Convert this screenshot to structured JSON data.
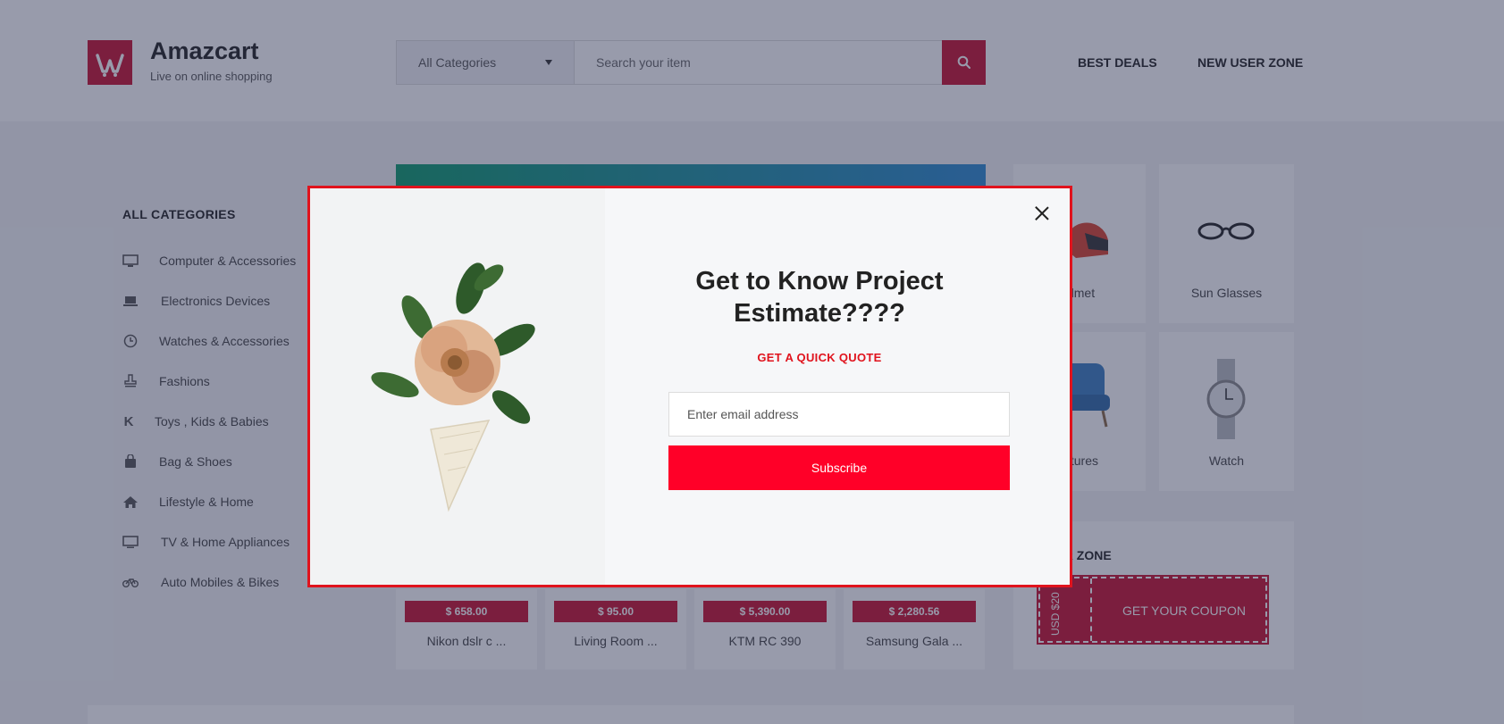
{
  "header": {
    "brand": "Amazcart",
    "tagline": "Live on online shopping",
    "search": {
      "category": "All Categories",
      "placeholder": "Search your item"
    },
    "nav": [
      "BEST DEALS",
      "NEW USER ZONE"
    ]
  },
  "sidebar": {
    "title": "ALL CATEGORIES",
    "items": [
      {
        "label": "Computer & Accessories",
        "icon": "monitor-icon"
      },
      {
        "label": "Electronics Devices",
        "icon": "laptop-icon"
      },
      {
        "label": "Watches & Accessories",
        "icon": "clock-icon"
      },
      {
        "label": "Fashions",
        "icon": "stamp-icon"
      },
      {
        "label": "Toys , Kids & Babies",
        "icon": "k-icon"
      },
      {
        "label": "Bag & Shoes",
        "icon": "bag-icon"
      },
      {
        "label": "Lifestyle & Home",
        "icon": "home-icon"
      },
      {
        "label": "TV & Home Appliances",
        "icon": "tv-icon"
      },
      {
        "label": "Auto Mobiles & Bikes",
        "icon": "bike-icon"
      }
    ]
  },
  "tiles": [
    {
      "label": "elmet",
      "icon": "helmet-icon"
    },
    {
      "label": "Sun Glasses",
      "icon": "sunglasses-icon"
    },
    {
      "label": "nitures",
      "icon": "armchair-icon"
    },
    {
      "label": "Watch",
      "icon": "watch-icon"
    }
  ],
  "products": [
    {
      "price": "$ 658.00",
      "name": "Nikon dslr c ..."
    },
    {
      "price": "$ 95.00",
      "name": "Living Room ..."
    },
    {
      "price": "$ 5,390.00",
      "name": "KTM RC 390"
    },
    {
      "price": "$ 2,280.56",
      "name": "Samsung Gala ..."
    }
  ],
  "coupon_zone": {
    "title": "USER ZONE",
    "amount": "USD $20",
    "cta": "GET YOUR COUPON"
  },
  "modal": {
    "heading_line1": "Get to Know Project",
    "heading_line2": "Estimate????",
    "subheading": "GET A QUICK QUOTE",
    "email_placeholder": "Enter email address",
    "button": "Subscribe"
  },
  "colors": {
    "brand": "#c8102e",
    "modal_border": "#e0131d",
    "subscribe": "#ff0028"
  }
}
